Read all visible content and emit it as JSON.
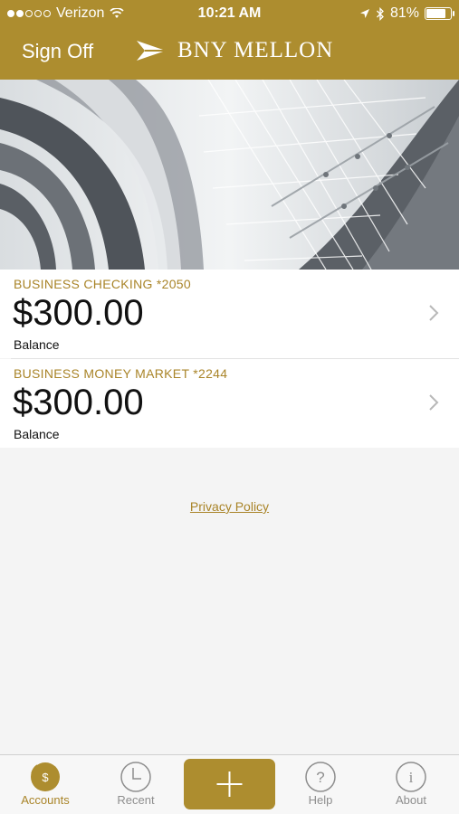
{
  "status_bar": {
    "carrier": "Verizon",
    "time": "10:21 AM",
    "battery": "81%",
    "battery_level": 0.81
  },
  "header": {
    "signoff_label": "Sign Off",
    "brand_name": "BNY MELLON"
  },
  "accounts": [
    {
      "name": "BUSINESS CHECKING *2050",
      "balance": "$300.00",
      "balance_label": "Balance"
    },
    {
      "name": "BUSINESS MONEY MARKET *2244",
      "balance": "$300.00",
      "balance_label": "Balance"
    }
  ],
  "privacy_policy": "Privacy Policy",
  "tabbar": {
    "accounts": "Accounts",
    "recent": "Recent",
    "help": "Help",
    "about": "About"
  },
  "colors": {
    "brand_gold": "#ad8d2f",
    "accent_text": "#a98428"
  }
}
